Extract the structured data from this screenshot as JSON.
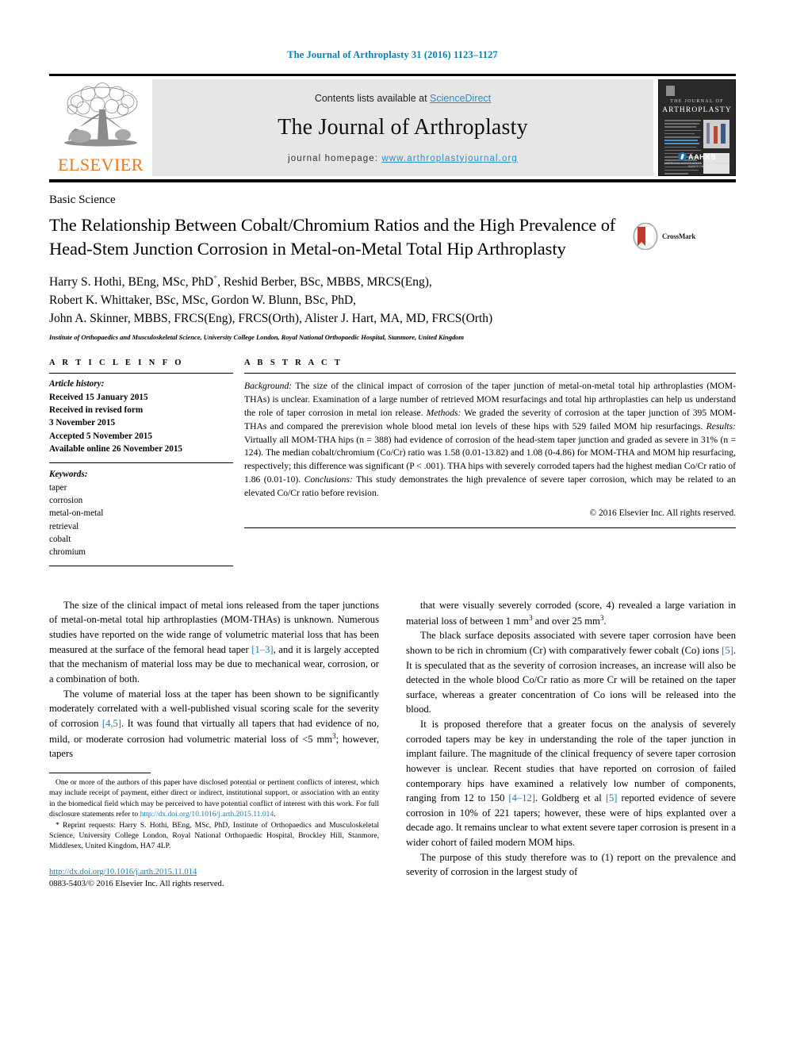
{
  "header": {
    "citation": "The Journal of Arthroplasty 31 (2016) 1123–1127",
    "contents_prefix": "Contents lists available at ",
    "contents_link": "ScienceDirect",
    "journal_title": "The Journal of Arthroplasty",
    "homepage_prefix": "journal homepage: ",
    "homepage_url": "www.arthroplastyjournal.org",
    "publisher_logo_text": "ELSEVIER",
    "cover": {
      "line1": "THE JOURNAL OF",
      "line2": "ARTHROPLASTY",
      "society": "AAHKS",
      "society_sub": "AMERICAN ASSOCIATION OF HIP AND KNEE SURGEONS"
    }
  },
  "article": {
    "section_label": "Basic Science",
    "title": "The Relationship Between Cobalt/Chromium Ratios and the High Prevalence of Head-Stem Junction Corrosion in Metal-on-Metal Total Hip Arthroplasty",
    "crossmark_label": "CrossMark",
    "authors_line1_a": "Harry S. Hothi, BEng, MSc, PhD",
    "authors_line1_b": ", Reshid Berber, BSc, MBBS, MRCS(Eng),",
    "authors_line2": "Robert K. Whittaker, BSc, MSc, Gordon W. Blunn, BSc, PhD,",
    "authors_line3": "John A. Skinner, MBBS, FRCS(Eng), FRCS(Orth), Alister J. Hart, MA, MD, FRCS(Orth)",
    "author_marker": "*",
    "affiliation": "Institute of Orthopaedics and Musculoskeletal Science, University College London, Royal National Orthopaedic Hospital, Stanmore, United Kingdom"
  },
  "article_info": {
    "heading": "A R T I C L E   I N F O",
    "history_label": "Article history:",
    "history": [
      "Received 15 January 2015",
      "Received in revised form",
      "3 November 2015",
      "Accepted 5 November 2015",
      "Available online 26 November 2015"
    ],
    "keywords_label": "Keywords:",
    "keywords": [
      "taper",
      "corrosion",
      "metal-on-metal",
      "retrieval",
      "cobalt",
      "chromium"
    ]
  },
  "abstract": {
    "heading": "A B S T R A C T",
    "sections": [
      {
        "label": "Background:",
        "text": "The size of the clinical impact of corrosion of the taper junction of metal-on-metal total hip arthroplasties (MOM-THAs) is unclear. Examination of a large number of retrieved MOM resurfacings and total hip arthroplasties can help us understand the role of taper corrosion in metal ion release."
      },
      {
        "label": "Methods:",
        "text": "We graded the severity of corrosion at the taper junction of 395 MOM-THAs and compared the prerevision whole blood metal ion levels of these hips with 529 failed MOM hip resurfacings."
      },
      {
        "label": "Results:",
        "text": "Virtually all MOM-THA hips (n = 388) had evidence of corrosion of the head-stem taper junction and graded as severe in 31% (n = 124). The median cobalt/chromium (Co/Cr) ratio was 1.58 (0.01-13.82) and 1.08 (0-4.86) for MOM-THA and MOM hip resurfacing, respectively; this difference was significant (P < .001). THA hips with severely corroded tapers had the highest median Co/Cr ratio of 1.86 (0.01-10)."
      },
      {
        "label": "Conclusions:",
        "text": "This study demonstrates the high prevalence of severe taper corrosion, which may be related to an elevated Co/Cr ratio before revision."
      }
    ],
    "copyright": "© 2016 Elsevier Inc. All rights reserved."
  },
  "body": {
    "left_paragraphs": [
      "The size of the clinical impact of metal ions released from the taper junctions of metal-on-metal total hip arthroplasties (MOM-THAs) is unknown. Numerous studies have reported on the wide range of volumetric material loss that has been measured at the surface of the femoral head taper [1–3], and it is largely accepted that the mechanism of material loss may be due to mechanical wear, corrosion, or a combination of both.",
      "The volume of material loss at the taper has been shown to be significantly moderately correlated with a well-published visual scoring scale for the severity of corrosion [4,5]. It was found that virtually all tapers that had evidence of no, mild, or moderate corrosion had volumetric material loss of <5 mm3; however, tapers"
    ],
    "left_refs": [
      "[1–3]",
      "[4,5]"
    ],
    "right_paragraphs": [
      "that were visually severely corroded (score, 4) revealed a large variation in material loss of between 1 mm3 and over 25 mm3.",
      "The black surface deposits associated with severe taper corrosion have been shown to be rich in chromium (Cr) with comparatively fewer cobalt (Co) ions [5]. It is speculated that as the severity of corrosion increases, an increase will also be detected in the whole blood Co/Cr ratio as more Cr will be retained on the taper surface, whereas a greater concentration of Co ions will be released into the blood.",
      "It is proposed therefore that a greater focus on the analysis of severely corroded tapers may be key in understanding the role of the taper junction in implant failure. The magnitude of the clinical frequency of severe taper corrosion however is unclear. Recent studies that have reported on corrosion of failed contemporary hips have examined a relatively low number of components, ranging from 12 to 150 [4–12]. Goldberg et al [5] reported evidence of severe corrosion in 10% of 221 tapers; however, these were of hips explanted over a decade ago. It remains unclear to what extent severe taper corrosion is present in a wider cohort of failed modern MOM hips.",
      "The purpose of this study therefore was to (1) report on the prevalence and severity of corrosion in the largest study of"
    ],
    "right_refs": [
      "[5]",
      "[4–12]",
      "[5]"
    ]
  },
  "footnotes": {
    "conflict": "One or more of the authors of this paper have disclosed potential or pertinent conflicts of interest, which may include receipt of payment, either direct or indirect, institutional support, or association with an entity in the biomedical field which may be perceived to have potential conflict of interest with this work. For full disclosure statements refer to ",
    "conflict_link": "http://dx.doi.org/10.1016/j.arth.2015.11.014",
    "conflict_end": ".",
    "reprint_marker": "*",
    "reprint": "Reprint requests: Harry S. Hothi, BEng, MSc, PhD, Institute of Orthopaedics and Musculoskeletal Science, University College London, Royal National Orthopaedic Hospital, Brockley Hill, Stanmore, Middlesex, United Kingdom, HA7 4LP.",
    "doi_url": "http://dx.doi.org/10.1016/j.arth.2015.11.014",
    "issn_line": "0883-5403/© 2016 Elsevier Inc. All rights reserved."
  },
  "colors": {
    "link": "#1a7cb0",
    "header_band": "#e6e6e6",
    "elsevier_orange": "#e87722",
    "crossmark_red": "#c0392b"
  }
}
